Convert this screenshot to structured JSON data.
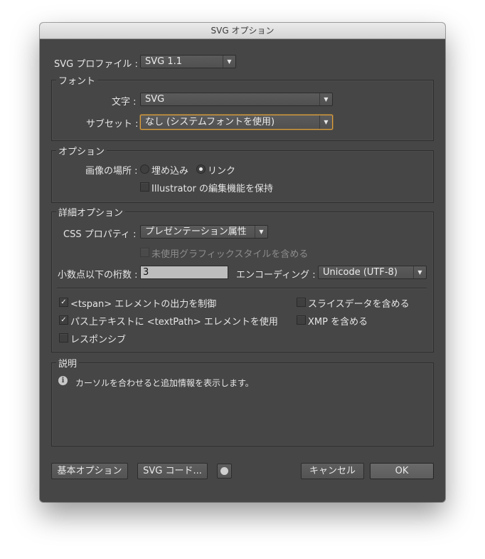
{
  "window": {
    "title": "SVG オプション"
  },
  "profile": {
    "label": "SVG プロファイル :",
    "value": "SVG 1.1"
  },
  "font": {
    "group_title": "フォント",
    "type_label": "文字 :",
    "type_value": "SVG",
    "subset_label": "サブセット :",
    "subset_value": "なし (システムフォントを使用)"
  },
  "options": {
    "group_title": "オプション",
    "image_location_label": "画像の場所 :",
    "embed_label": "埋め込み",
    "link_label": "リンク",
    "selected": "link",
    "preserve_label": "Illustrator の編集機能を保持",
    "preserve_checked": false
  },
  "advanced": {
    "group_title": "詳細オプション",
    "css_label": "CSS プロパティ :",
    "css_value": "プレゼンテーション属性",
    "include_unused_label": "未使用グラフィックスタイルを含める",
    "decimal_label": "小数点以下の桁数 :",
    "decimal_value": "3",
    "encoding_label": "エンコーディング :",
    "encoding_value": "Unicode (UTF-8)",
    "tspan_label": "<tspan> エレメントの出力を制御",
    "tspan_checked": true,
    "textpath_label": "パス上テキストに <textPath> エレメントを使用",
    "textpath_checked": true,
    "responsive_label": "レスポンシブ",
    "responsive_checked": false,
    "slice_label": "スライスデータを含める",
    "slice_checked": false,
    "xmp_label": "XMP を含める",
    "xmp_checked": false
  },
  "description": {
    "group_title": "説明",
    "text": "カーソルを合わせると追加情報を表示します。"
  },
  "buttons": {
    "basic_options": "基本オプション",
    "svg_code": "SVG コード...",
    "cancel": "キャンセル",
    "ok": "OK"
  },
  "check_mark": "✓",
  "colors": {
    "dialog_bg": "#464646",
    "focus_ring": "#e1a03a"
  }
}
